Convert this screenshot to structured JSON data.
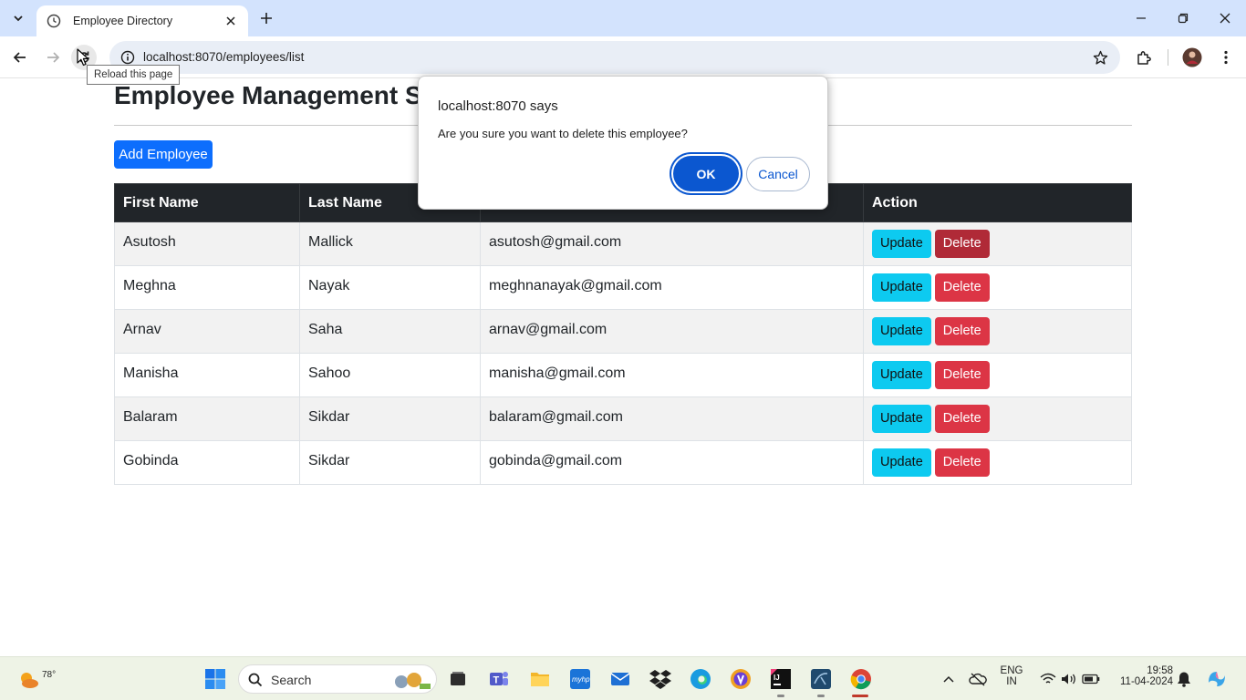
{
  "browser": {
    "tab_title": "Employee Directory",
    "url": "localhost:8070/employees/list",
    "tooltip": "Reload this page"
  },
  "page": {
    "title": "Employee Management Sy",
    "add_button": "Add Employee",
    "columns": [
      "First Name",
      "Last Name",
      "",
      "Action"
    ],
    "update_label": "Update",
    "delete_label": "Delete",
    "rows": [
      {
        "first": "Asutosh",
        "last": "Mallick",
        "email": "asutosh@gmail.com"
      },
      {
        "first": "Meghna",
        "last": "Nayak",
        "email": "meghnanayak@gmail.com"
      },
      {
        "first": "Arnav",
        "last": "Saha",
        "email": "arnav@gmail.com"
      },
      {
        "first": "Manisha",
        "last": "Sahoo",
        "email": "manisha@gmail.com"
      },
      {
        "first": "Balaram",
        "last": "Sikdar",
        "email": "balaram@gmail.com"
      },
      {
        "first": "Gobinda",
        "last": "Sikdar",
        "email": "gobinda@gmail.com"
      }
    ]
  },
  "dialog": {
    "title": "localhost:8070 says",
    "message": "Are you sure you want to delete this employee?",
    "ok_label": "OK",
    "cancel_label": "Cancel"
  },
  "taskbar": {
    "weather_temp": "78°",
    "search_label": "Search",
    "lang_line1": "ENG",
    "lang_line2": "IN",
    "time": "19:58",
    "date": "11-04-2024"
  },
  "colors": {
    "primary": "#0d6efd",
    "info": "#0dcaf0",
    "danger": "#dc3545",
    "table_header": "#212529",
    "dialog_accent": "#0b57d0"
  }
}
